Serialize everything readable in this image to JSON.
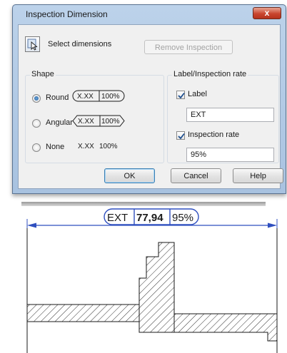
{
  "dialog": {
    "title": "Inspection Dimension",
    "close_glyph": "x",
    "select_label": "Select dimensions",
    "remove_button": "Remove Inspection",
    "shape": {
      "title": "Shape",
      "options": [
        {
          "label": "Round",
          "checked": true
        },
        {
          "label": "Angular",
          "checked": false
        },
        {
          "label": "None",
          "checked": false
        }
      ],
      "preview_value": "X.XX",
      "preview_rate": "100%"
    },
    "label_rate": {
      "title": "Label/Inspection rate",
      "label_check": "Label",
      "label_checked": true,
      "label_value": "EXT",
      "rate_check": "Inspection rate",
      "rate_checked": true,
      "rate_value": "95%"
    },
    "buttons": {
      "ok": "OK",
      "cancel": "Cancel",
      "help": "Help"
    }
  },
  "drawing": {
    "dim_label": "EXT",
    "dim_value": "77,94",
    "dim_rate": "95%",
    "accent_color": "#2f4fbf",
    "line_color": "#1a1a1a"
  }
}
